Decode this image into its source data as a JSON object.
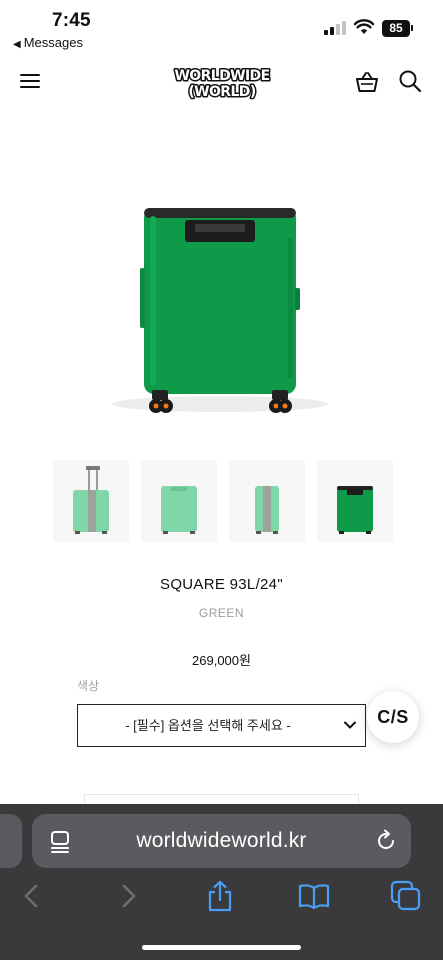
{
  "status_bar": {
    "time": "7:45",
    "back_app": "Messages",
    "battery": "85"
  },
  "header": {
    "logo_line1": "WORLDWIDE",
    "logo_line2": "(WORLD)",
    "icons": [
      "menu-icon",
      "cart-icon",
      "search-icon"
    ]
  },
  "product": {
    "name": "SQUARE 93L/24\"",
    "color_name": "GREEN",
    "price": "269,000원",
    "thumbnails": [
      {
        "icon": "suitcase-handle-extended-thumbnail",
        "tint": "#7fd6a6"
      },
      {
        "icon": "suitcase-front-thumbnail",
        "tint": "#7fd6a6"
      },
      {
        "icon": "suitcase-side-thumbnail",
        "tint": "#7fd6a6"
      },
      {
        "icon": "suitcase-back-thumbnail",
        "tint": "#0f9a4a"
      }
    ],
    "main_color": "#0f9a4a"
  },
  "options": {
    "label": "색상",
    "select_placeholder": "- [필수] 옵션을 선택해 주세요 -"
  },
  "cs_button": {
    "label": "C/S"
  },
  "browser": {
    "url": "worldwideworld.kr",
    "toolbar": [
      "back-icon",
      "forward-icon",
      "share-icon",
      "bookmarks-icon",
      "tabs-icon"
    ],
    "accent": "#4a9ff5"
  }
}
